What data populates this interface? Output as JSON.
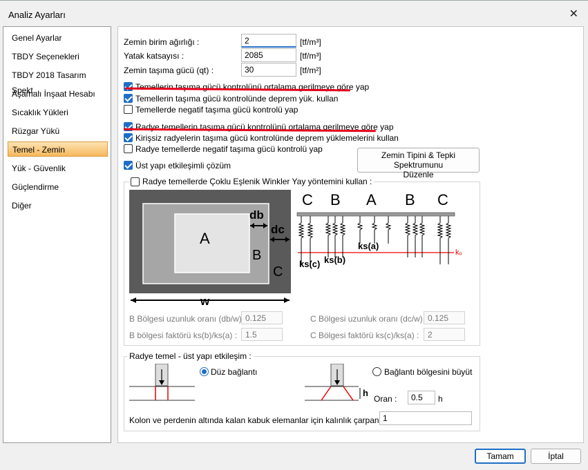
{
  "window": {
    "title": "Analiz Ayarları"
  },
  "sidebar": {
    "items": [
      {
        "label": "Genel Ayarlar"
      },
      {
        "label": "TBDY Seçenekleri"
      },
      {
        "label": "TBDY 2018 Tasarım Spekt..."
      },
      {
        "label": "Aşamalı İnşaat Hesabı"
      },
      {
        "label": "Sıcaklık Yükleri"
      },
      {
        "label": "Rüzgar Yükü"
      },
      {
        "label": "Temel - Zemin",
        "selected": true
      },
      {
        "label": "Yük - Güvenlik"
      },
      {
        "label": "Güçlendirme"
      },
      {
        "label": "Diğer"
      }
    ]
  },
  "fields": {
    "unit_weight": {
      "label": "Zemin birim ağırlığı :",
      "value": "2",
      "unit": "[tf/m³]"
    },
    "bed_coef": {
      "label": "Yatak katsayısı :",
      "value": "2085",
      "unit": "[tf/m³]"
    },
    "bearing": {
      "label": "Zemin taşıma gücü (qt) :",
      "value": "30",
      "unit": "[tf/m²]"
    }
  },
  "checks": [
    {
      "label": "Temellerin taşıma gücü kontrolünü ortalama gerilmeye göre yap",
      "checked": true
    },
    {
      "label": "Temellerin taşıma gücü kontrolünde deprem yük. kullan",
      "checked": true
    },
    {
      "label": "Temellerde negatif taşıma gücü kontrolü yap",
      "checked": false
    },
    {
      "label": "Radye temellerin taşıma gücü kontrolünü ortalama gerilmeye göre yap",
      "checked": true
    },
    {
      "label": "Kirişsiz radyelerin taşıma gücü kontrolünde deprem yüklemelerini kullan",
      "checked": true
    },
    {
      "label": "Radye temellerde negatif taşıma gücü kontrolü yap",
      "checked": false
    },
    {
      "label": "Üst yapı etkileşimli çözüm",
      "checked": true
    }
  ],
  "spectrum_button": {
    "line1": "Zemin Tipini  & Tepki Spektrumunu",
    "line2": "Düzenle"
  },
  "winkler": {
    "title": "Radye temellerde Çoklu Eşlenik Winkler Yay yöntemini kullan :",
    "checked": false,
    "diagram_left": {
      "A": "A",
      "B": "B",
      "C": "C",
      "db": "db",
      "dc": "dc",
      "w": "w"
    },
    "diagram_right": {
      "labels": [
        "C",
        "B",
        "A",
        "B",
        "C"
      ],
      "ksa": "ks(a)",
      "ksb": "ks(b)",
      "ksc": "ks(c)",
      "ko": "kₒ"
    },
    "b_ratio": {
      "label": "B Bölgesi uzunluk oranı (db/w) :",
      "value": "0.125"
    },
    "c_ratio": {
      "label": "C Bölgesi uzunluk oranı (dc/w) :",
      "value": "0.125"
    },
    "b_factor": {
      "label": "B bölgesi faktörü ks(b)/ks(a) :",
      "value": "1.5"
    },
    "c_factor": {
      "label": "C Bölgesi faktörü ks(c)/ks(a) :",
      "value": "2"
    }
  },
  "interaction": {
    "title": "Radye temel - üst yapı etkileşim :",
    "opt1": {
      "label": "Düz bağlantı",
      "selected": true
    },
    "opt2": {
      "label": "Bağlantı bölgesini büyüt",
      "selected": false
    },
    "h_label": "h",
    "ratio_label": "Oran :",
    "ratio_value": "0.5",
    "ratio_unit": "h",
    "thickness_label": "Kolon ve perdenin altında kalan kabuk elemanlar için kalınlık çarpanı :",
    "thickness_value": "1"
  },
  "footer": {
    "ok": "Tamam",
    "cancel": "İptal"
  },
  "colors": {
    "accent": "#1f6ec6",
    "annotation_red": "#e5001a",
    "selected_item": "#f6b85c"
  }
}
